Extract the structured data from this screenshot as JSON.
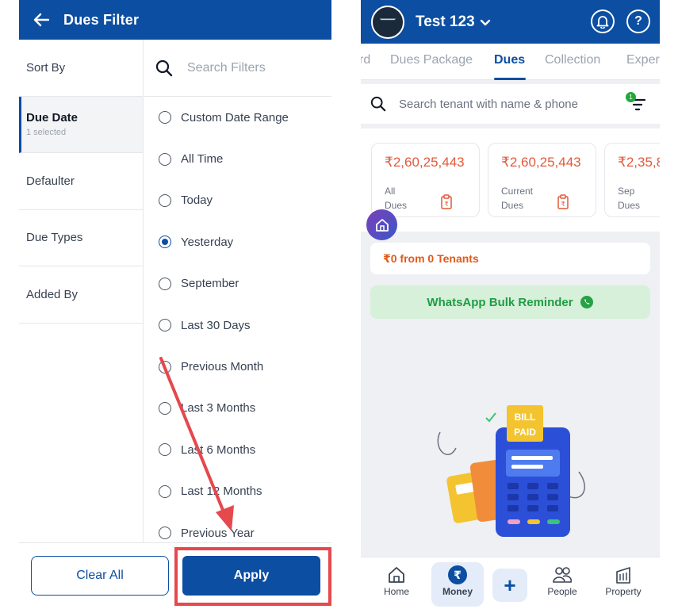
{
  "left_screen": {
    "header": {
      "title": "Dues Filter",
      "back_icon": "arrow-left-icon"
    },
    "sidebar": [
      {
        "label": "Sort By",
        "sub": ""
      },
      {
        "label": "Due Date",
        "sub": "1 selected",
        "active": true
      },
      {
        "label": "Defaulter",
        "sub": ""
      },
      {
        "label": "Due Types",
        "sub": ""
      },
      {
        "label": "Added By",
        "sub": ""
      }
    ],
    "search": {
      "placeholder": "Search Filters",
      "value": ""
    },
    "options": [
      {
        "label": "Custom Date Range",
        "selected": false
      },
      {
        "label": "All Time",
        "selected": false
      },
      {
        "label": "Today",
        "selected": false
      },
      {
        "label": "Yesterday",
        "selected": true
      },
      {
        "label": "September",
        "selected": false
      },
      {
        "label": "Last 30 Days",
        "selected": false
      },
      {
        "label": "Previous Month",
        "selected": false
      },
      {
        "label": "Last 3 Months",
        "selected": false
      },
      {
        "label": "Last 6 Months",
        "selected": false
      },
      {
        "label": "Last 12 Months",
        "selected": false
      },
      {
        "label": "Previous Year",
        "selected": false
      }
    ],
    "footer": {
      "clear_label": "Clear All",
      "apply_label": "Apply"
    },
    "annotation_color": "#e5484d"
  },
  "right_screen": {
    "header": {
      "property_name": "Test 123",
      "bell_icon": "bell-icon",
      "help_icon": "question-icon"
    },
    "tabs": [
      "rd",
      "Dues Package",
      "Dues",
      "Collection",
      "Exper"
    ],
    "active_tab": "Dues",
    "search": {
      "placeholder": "Search tenant with name & phone",
      "filter_badge": "1"
    },
    "cards": [
      {
        "amount": "₹2,60,25,443",
        "label_line1": "All",
        "label_line2": "Dues"
      },
      {
        "amount": "₹2,60,25,443",
        "label_line1": "Current",
        "label_line2": "Dues"
      },
      {
        "amount": "₹2,35,8",
        "label_line1": "Sep",
        "label_line2": "Dues"
      }
    ],
    "summary": "₹0 from 0 Tenants",
    "whatsapp_label": "WhatsApp Bulk Reminder",
    "illustration_text": [
      "BILL",
      "PAID"
    ],
    "bottom_nav": [
      {
        "label": "Home",
        "icon": "home-icon"
      },
      {
        "label": "Money",
        "icon": "rupee-icon",
        "active": true
      },
      {
        "label": "+",
        "icon": "plus-icon"
      },
      {
        "label": "People",
        "icon": "people-icon"
      },
      {
        "label": "Property",
        "icon": "building-icon"
      }
    ],
    "colors": {
      "brand": "#0b4ea2",
      "amount": "#e05a3a",
      "whatsapp": "#1f9d43",
      "badge": "#22a93a"
    }
  }
}
